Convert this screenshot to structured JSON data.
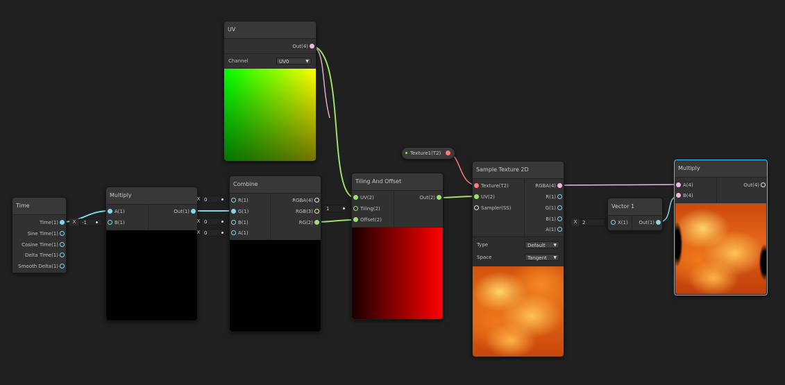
{
  "colors": {
    "background": "#202020",
    "selection": "#44c0ff",
    "port_vector1": "#7ed8e6",
    "port_vector2": "#9ee06c",
    "port_vector3": "#f5f07a",
    "port_vector4": "#f0b8e0",
    "port_texture": "#ff7a7a"
  },
  "time": {
    "title": "Time",
    "outputs": [
      "Time(1)",
      "Sine Time(1)",
      "Cosine Time(1)",
      "Delta Time(1)",
      "Smooth Delta(1)"
    ]
  },
  "multiply1": {
    "title": "Multiply",
    "inputs": [
      "A(1)",
      "B(1)"
    ],
    "output": "Out(1)",
    "b_field_label": "X",
    "b_field_value": "-1"
  },
  "combine": {
    "title": "Combine",
    "inputs": [
      "R(1)",
      "G(1)",
      "B(1)",
      "A(1)"
    ],
    "outputs": [
      "RGBA(4)",
      "RGB(3)",
      "RG(2)"
    ],
    "r_field_label": "X",
    "r_field_value": "0",
    "b_field_label": "X",
    "b_field_value": "0",
    "a_field_label": "X",
    "a_field_value": "0"
  },
  "uv": {
    "title": "UV",
    "output": "Out(4)",
    "channel_label": "Channel",
    "channel_value": "UV0"
  },
  "tiling": {
    "title": "Tiling And Offset",
    "inputs": [
      "UV(2)",
      "Tiling(2)",
      "Offset(2)"
    ],
    "output": "Out(2)",
    "tiling_field_value": "1"
  },
  "texture_property": {
    "label": "Texture1(T2)"
  },
  "sample": {
    "title": "Sample Texture 2D",
    "inputs": [
      "Texture(T2)",
      "UV(2)",
      "Sampler(SS)"
    ],
    "outputs": [
      "RGBA(4)",
      "R(1)",
      "G(1)",
      "B(1)",
      "A(1)"
    ],
    "type_label": "Type",
    "type_value": "Default",
    "space_label": "Space",
    "space_value": "Tangent"
  },
  "vector1": {
    "title": "Vector 1",
    "input": "X(1)",
    "output": "Out(1)",
    "field_label": "X",
    "field_value": "2"
  },
  "multiply2": {
    "title": "Multiply",
    "inputs": [
      "A(4)",
      "B(4)"
    ],
    "output": "Out(4)"
  },
  "icons": {
    "dropdown": "chevron-down-icon",
    "port": "port-circle-icon"
  }
}
